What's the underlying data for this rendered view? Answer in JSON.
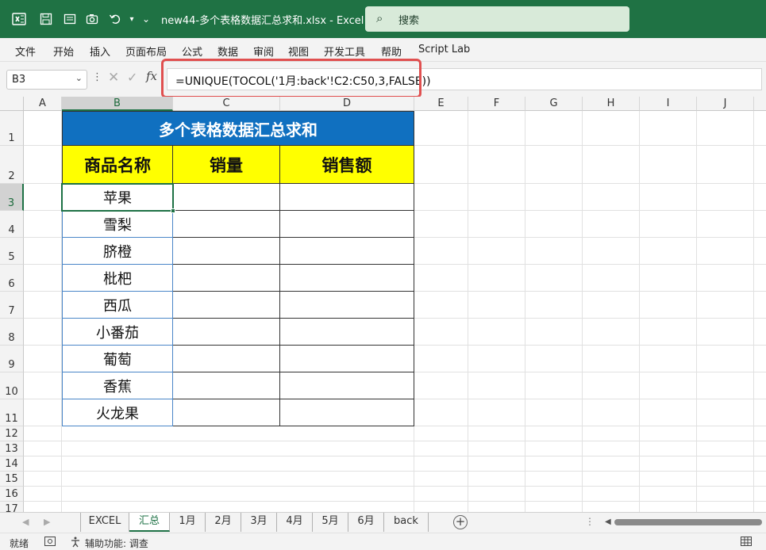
{
  "window": {
    "title": "new44-多个表格数据汇总求和.xlsx  -  Excel",
    "search_placeholder": "搜索"
  },
  "menu": [
    "文件",
    "开始",
    "插入",
    "页面布局",
    "公式",
    "数据",
    "审阅",
    "视图",
    "开发工具",
    "帮助",
    "Script Lab"
  ],
  "formula_bar": {
    "name_box": "B3",
    "fx": "fx",
    "formula": "=UNIQUE(TOCOL('1月:back'!C2:C50,3,FALSE))"
  },
  "columns": [
    "A",
    "B",
    "C",
    "D",
    "E",
    "F",
    "G",
    "H",
    "I",
    "J"
  ],
  "rows": [
    "1",
    "2",
    "3",
    "4",
    "5",
    "6",
    "7",
    "8",
    "9",
    "10",
    "11",
    "12",
    "13",
    "14",
    "15",
    "16",
    "17"
  ],
  "table": {
    "title": "多个表格数据汇总求和",
    "headers": [
      "商品名称",
      "销量",
      "销售额"
    ],
    "items": [
      "苹果",
      "雪梨",
      "脐橙",
      "枇杷",
      "西瓜",
      "小番茄",
      "葡萄",
      "香蕉",
      "火龙果"
    ]
  },
  "sheets": [
    "EXCEL",
    "汇总",
    "1月",
    "2月",
    "3月",
    "4月",
    "5月",
    "6月",
    "back"
  ],
  "active_sheet": "汇总",
  "status": {
    "ready": "就绪",
    "accessibility": "辅助功能: 调查"
  },
  "colors": {
    "excel_green": "#1f7244",
    "title_blue": "#1070c0",
    "header_yellow": "#ffff00",
    "highlight_red": "#e05050"
  }
}
